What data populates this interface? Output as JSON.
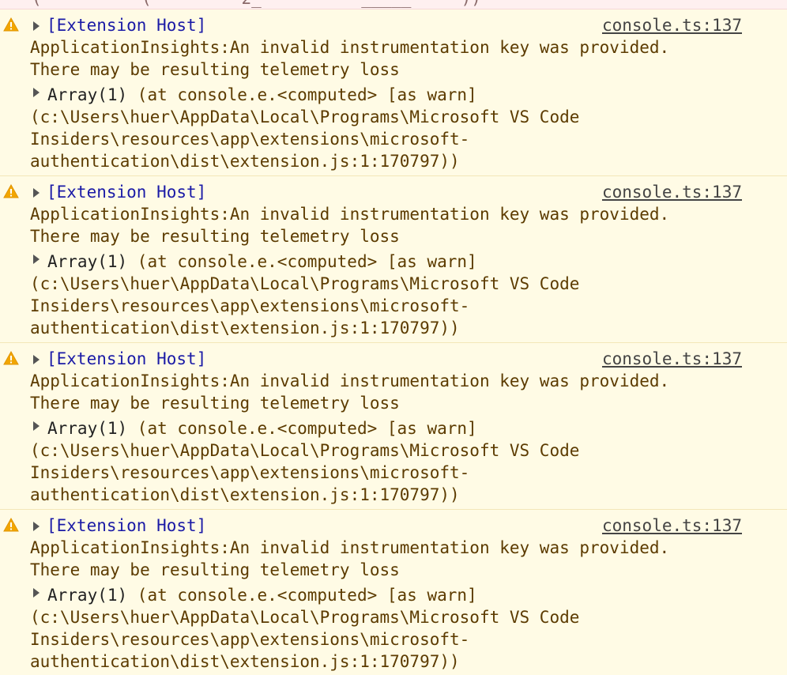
{
  "top_fragment": "(          (         2_          _____     ))",
  "entries": [
    {
      "tag": "[Extension Host]",
      "source": "console.ts:137",
      "message_line1": "ApplicationInsights:An invalid instrumentation key was provided.",
      "message_line2": "There may be resulting telemetry loss",
      "array_label": "Array(1)",
      "at_text": " (at console.e.<computed> [as warn]",
      "stack_line1": "(c:\\Users\\huer\\AppData\\Local\\Programs\\Microsoft VS Code",
      "stack_line2": "Insiders\\resources\\app\\extensions\\microsoft-",
      "stack_line3": "authentication\\dist\\extension.js:1:170797))"
    },
    {
      "tag": "[Extension Host]",
      "source": "console.ts:137",
      "message_line1": "ApplicationInsights:An invalid instrumentation key was provided.",
      "message_line2": "There may be resulting telemetry loss",
      "array_label": "Array(1)",
      "at_text": " (at console.e.<computed> [as warn]",
      "stack_line1": "(c:\\Users\\huer\\AppData\\Local\\Programs\\Microsoft VS Code",
      "stack_line2": "Insiders\\resources\\app\\extensions\\microsoft-",
      "stack_line3": "authentication\\dist\\extension.js:1:170797))"
    },
    {
      "tag": "[Extension Host]",
      "source": "console.ts:137",
      "message_line1": "ApplicationInsights:An invalid instrumentation key was provided.",
      "message_line2": "There may be resulting telemetry loss",
      "array_label": "Array(1)",
      "at_text": " (at console.e.<computed> [as warn]",
      "stack_line1": "(c:\\Users\\huer\\AppData\\Local\\Programs\\Microsoft VS Code",
      "stack_line2": "Insiders\\resources\\app\\extensions\\microsoft-",
      "stack_line3": "authentication\\dist\\extension.js:1:170797))"
    },
    {
      "tag": "[Extension Host]",
      "source": "console.ts:137",
      "message_line1": "ApplicationInsights:An invalid instrumentation key was provided.",
      "message_line2": "There may be resulting telemetry loss",
      "array_label": "Array(1)",
      "at_text": " (at console.e.<computed> [as warn]",
      "stack_line1": "(c:\\Users\\huer\\AppData\\Local\\Programs\\Microsoft VS Code",
      "stack_line2": "Insiders\\resources\\app\\extensions\\microsoft-",
      "stack_line3": "authentication\\dist\\extension.js:1:170797))"
    }
  ],
  "colors": {
    "warning_background": "#fffbe5",
    "warning_text": "#5c3b00",
    "warning_icon": "#f2a600",
    "tag_blue": "#1a1aa6",
    "error_strip": "#fef0f0"
  }
}
